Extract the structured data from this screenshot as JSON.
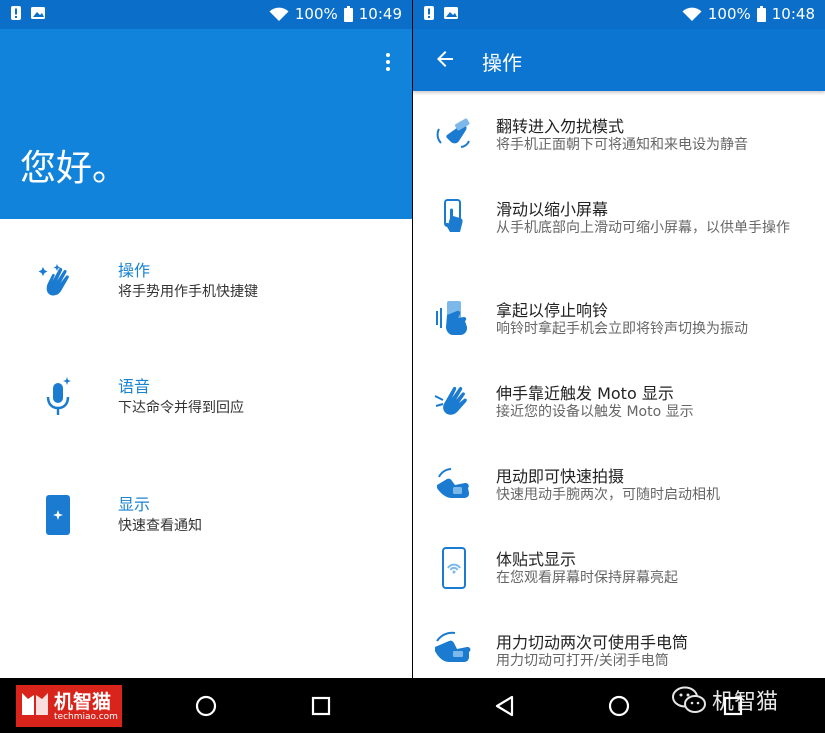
{
  "left_screen": {
    "status": {
      "battery": "100%",
      "time": "10:49"
    },
    "greeting": "您好。",
    "items": [
      {
        "title": "操作",
        "subtitle": "将手势用作手机快捷键",
        "icon": "hand-gesture-icon"
      },
      {
        "title": "语音",
        "subtitle": "下达命令并得到回应",
        "icon": "microphone-icon"
      },
      {
        "title": "显示",
        "subtitle": "快速查看通知",
        "icon": "phone-display-icon"
      }
    ]
  },
  "right_screen": {
    "status": {
      "battery": "100%",
      "time": "10:48"
    },
    "title": "操作",
    "gestures": [
      {
        "title": "翻转进入勿扰模式",
        "subtitle": "将手机正面朝下可将通知和来电设为静音",
        "icon": "flip-phone-icon"
      },
      {
        "title": "滑动以缩小屏幕",
        "subtitle": "从手机底部向上滑动可缩小屏幕，以供单手操作",
        "icon": "swipe-up-icon"
      },
      {
        "title": "拿起以停止响铃",
        "subtitle": "响铃时拿起手机会立即将铃声切换为振动",
        "icon": "pickup-phone-icon"
      },
      {
        "title": "伸手靠近触发 Moto 显示",
        "subtitle": "接近您的设备以触发 Moto 显示",
        "icon": "reach-hand-icon"
      },
      {
        "title": "甩动即可快速拍摄",
        "subtitle": "快速甩动手腕两次，可随时启动相机",
        "icon": "twist-camera-icon"
      },
      {
        "title": "体贴式显示",
        "subtitle": "在您观看屏幕时保持屏幕亮起",
        "icon": "attentive-display-icon"
      },
      {
        "title": "用力切动两次可使用手电筒",
        "subtitle": "用力切动可打开/关闭手电筒",
        "icon": "chop-flashlight-icon"
      }
    ]
  },
  "watermark": {
    "logo_name": "机智猫",
    "logo_site": "techmiao.com",
    "wechat_name": "机智猫"
  },
  "colors": {
    "status_bar": "#0b6fc9",
    "hero": "#1283db",
    "app_bar": "#0c75d2",
    "accent": "#1a83d0",
    "icon_blue": "#1b7bd0"
  }
}
